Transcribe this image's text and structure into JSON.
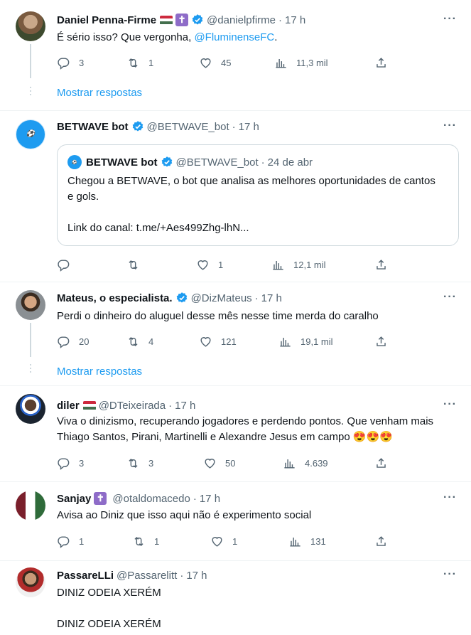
{
  "ui": {
    "more": "···",
    "show_replies": "Mostrar respostas",
    "dot": "·"
  },
  "colors": {
    "accent": "#1d9bf0",
    "muted": "#536471",
    "border": "#cfd9de"
  },
  "tweets": [
    {
      "name": "Daniel Penna-Firme",
      "handle": "@danielpfirme",
      "time": "17 h",
      "text_before": "É sério isso? Que vergonha, ",
      "mention": "@FluminenseFC",
      "text_after": ".",
      "replies": "3",
      "retweets": "1",
      "likes": "45",
      "views": "11,3 mil"
    },
    {
      "name": "BETWAVE bot",
      "handle": "@BETWAVE_bot",
      "time": "17 h",
      "quote": {
        "name": "BETWAVE bot",
        "handle": "@BETWAVE_bot",
        "time": "24 de abr",
        "text": "Chegou a BETWAVE, o bot que analisa as melhores oportunidades de cantos e gols.\n\nLink do canal: t.me/+Aes499Zhg-lhN..."
      },
      "replies": "",
      "retweets": "",
      "likes": "1",
      "views": "12,1 mil"
    },
    {
      "name": "Mateus, o especialista.",
      "handle": "@DizMateus",
      "time": "17 h",
      "text": "Perdi o dinheiro do aluguel desse mês nesse time merda do caralho",
      "replies": "20",
      "retweets": "4",
      "likes": "121",
      "views": "19,1 mil"
    },
    {
      "name": "diler",
      "handle": "@DTeixeirada",
      "time": "17 h",
      "text": "Viva o dinizismo, recuperando jogadores e perdendo pontos. Que venham mais Thiago Santos, Pirani, Martinelli e Alexandre Jesus em campo 😍😍😍",
      "replies": "3",
      "retweets": "3",
      "likes": "50",
      "views": "4.639"
    },
    {
      "name": "Sanjay",
      "handle": "@otaldomacedo",
      "time": "17 h",
      "text": "Avisa ao Diniz que isso aqui não é experimento social",
      "replies": "1",
      "retweets": "1",
      "likes": "1",
      "views": "131"
    },
    {
      "name": "PassareLLi",
      "handle": "@Passarelitt",
      "time": "17 h",
      "text": "DINIZ ODEIA XERÉM\n\nDINIZ ODEIA XERÉM"
    }
  ]
}
